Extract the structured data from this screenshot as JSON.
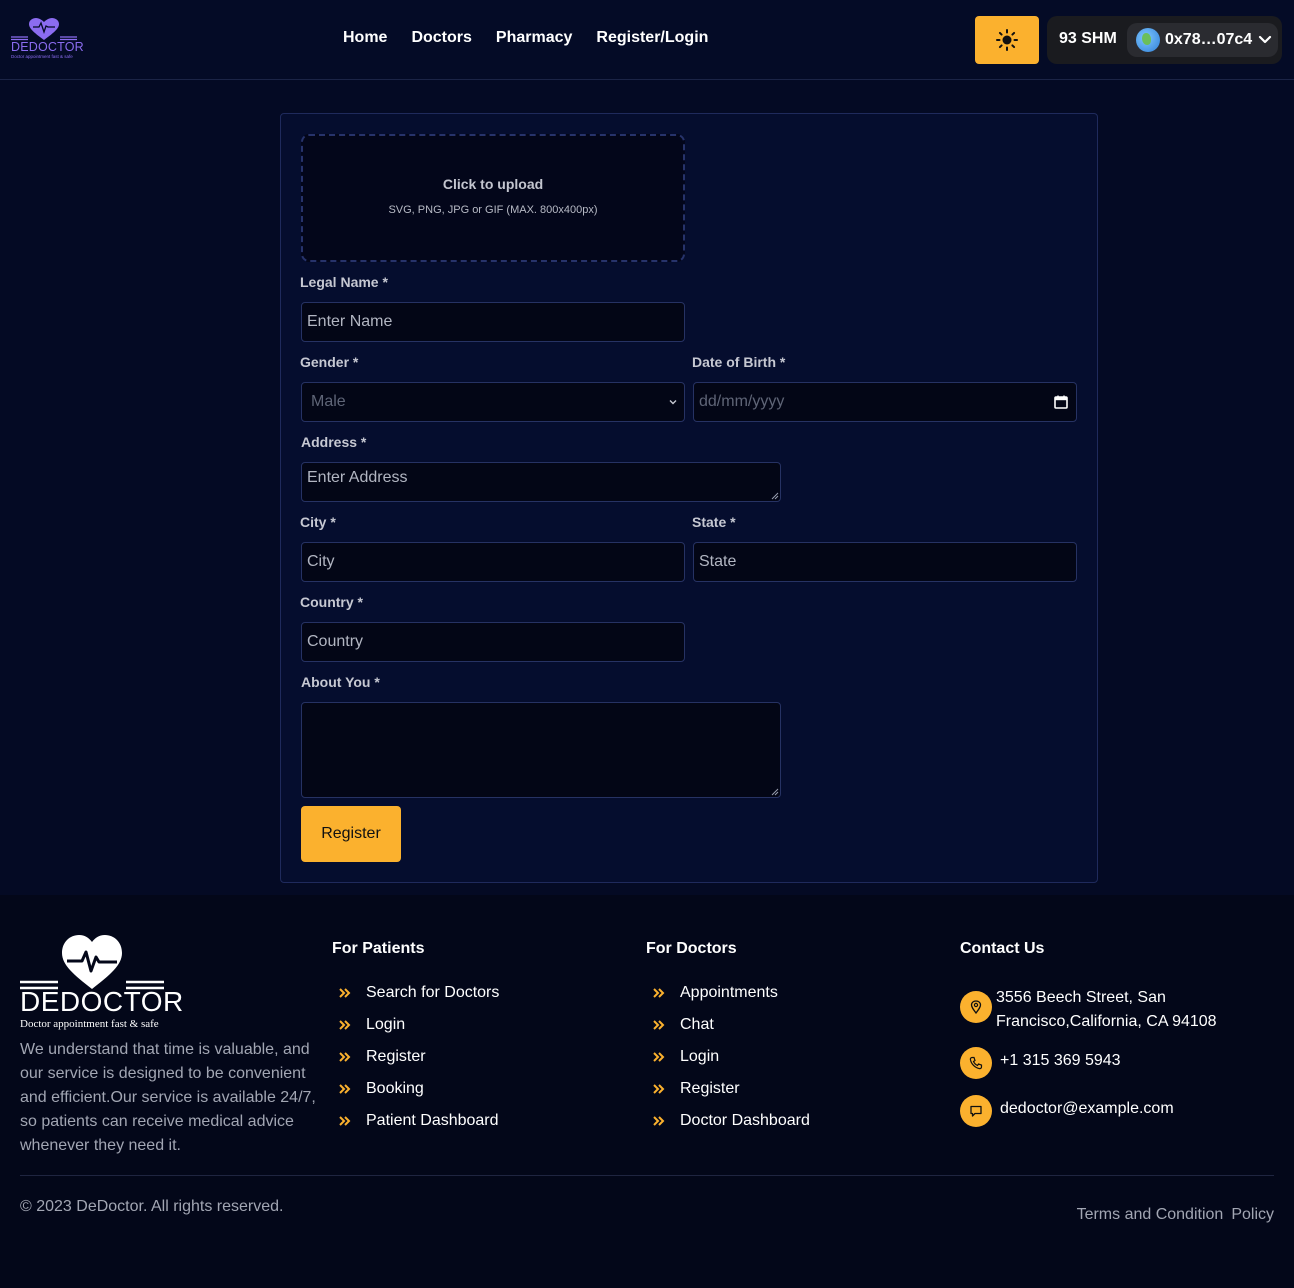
{
  "brand": {
    "name": "DEDOCTOR",
    "tagline": "Doctor appointment fast & safe",
    "accent_color": "#fbb12e",
    "logo_color": "#8b6cf0"
  },
  "nav": {
    "items": [
      "Home",
      "Doctors",
      "Pharmacy",
      "Register/Login"
    ]
  },
  "header": {
    "theme_toggle_icon": "sun-icon",
    "balance": "93 SHM",
    "account": "0x78…07c4"
  },
  "form": {
    "upload": {
      "title": "Click to upload",
      "subtitle": "SVG, PNG, JPG or GIF (MAX. 800x400px)"
    },
    "legal_name": {
      "label": "Legal Name *",
      "placeholder": "Enter Name"
    },
    "gender": {
      "label": "Gender *",
      "value": "Male"
    },
    "dob": {
      "label": "Date of Birth *",
      "placeholder": "dd/mm/yyyy"
    },
    "address": {
      "label": "Address *",
      "placeholder": "Enter Address"
    },
    "city": {
      "label": "City *",
      "placeholder": "City"
    },
    "state": {
      "label": "State *",
      "placeholder": "State"
    },
    "country": {
      "label": "Country *",
      "placeholder": "Country"
    },
    "about": {
      "label": "About You *",
      "value": ""
    },
    "submit_label": "Register"
  },
  "footer": {
    "description": "We understand that time is valuable, and our service is designed to be convenient and efficient.Our service is available 24/7, so patients can receive medical advice whenever they need it.",
    "patients": {
      "title": "For Patients",
      "links": [
        "Search for Doctors",
        "Login",
        "Register",
        "Booking",
        "Patient Dashboard"
      ]
    },
    "doctors": {
      "title": "For Doctors",
      "links": [
        "Appointments",
        "Chat",
        "Login",
        "Register",
        "Doctor Dashboard"
      ]
    },
    "contact": {
      "title": "Contact Us",
      "address": "3556 Beech Street, San Francisco,California, CA 94108",
      "phone": "+1 315 369 5943",
      "email": "dedoctor@example.com"
    },
    "copyright": "© 2023 DeDoctor. All rights reserved.",
    "legal_links": [
      "Terms and Condition",
      "Policy"
    ]
  }
}
